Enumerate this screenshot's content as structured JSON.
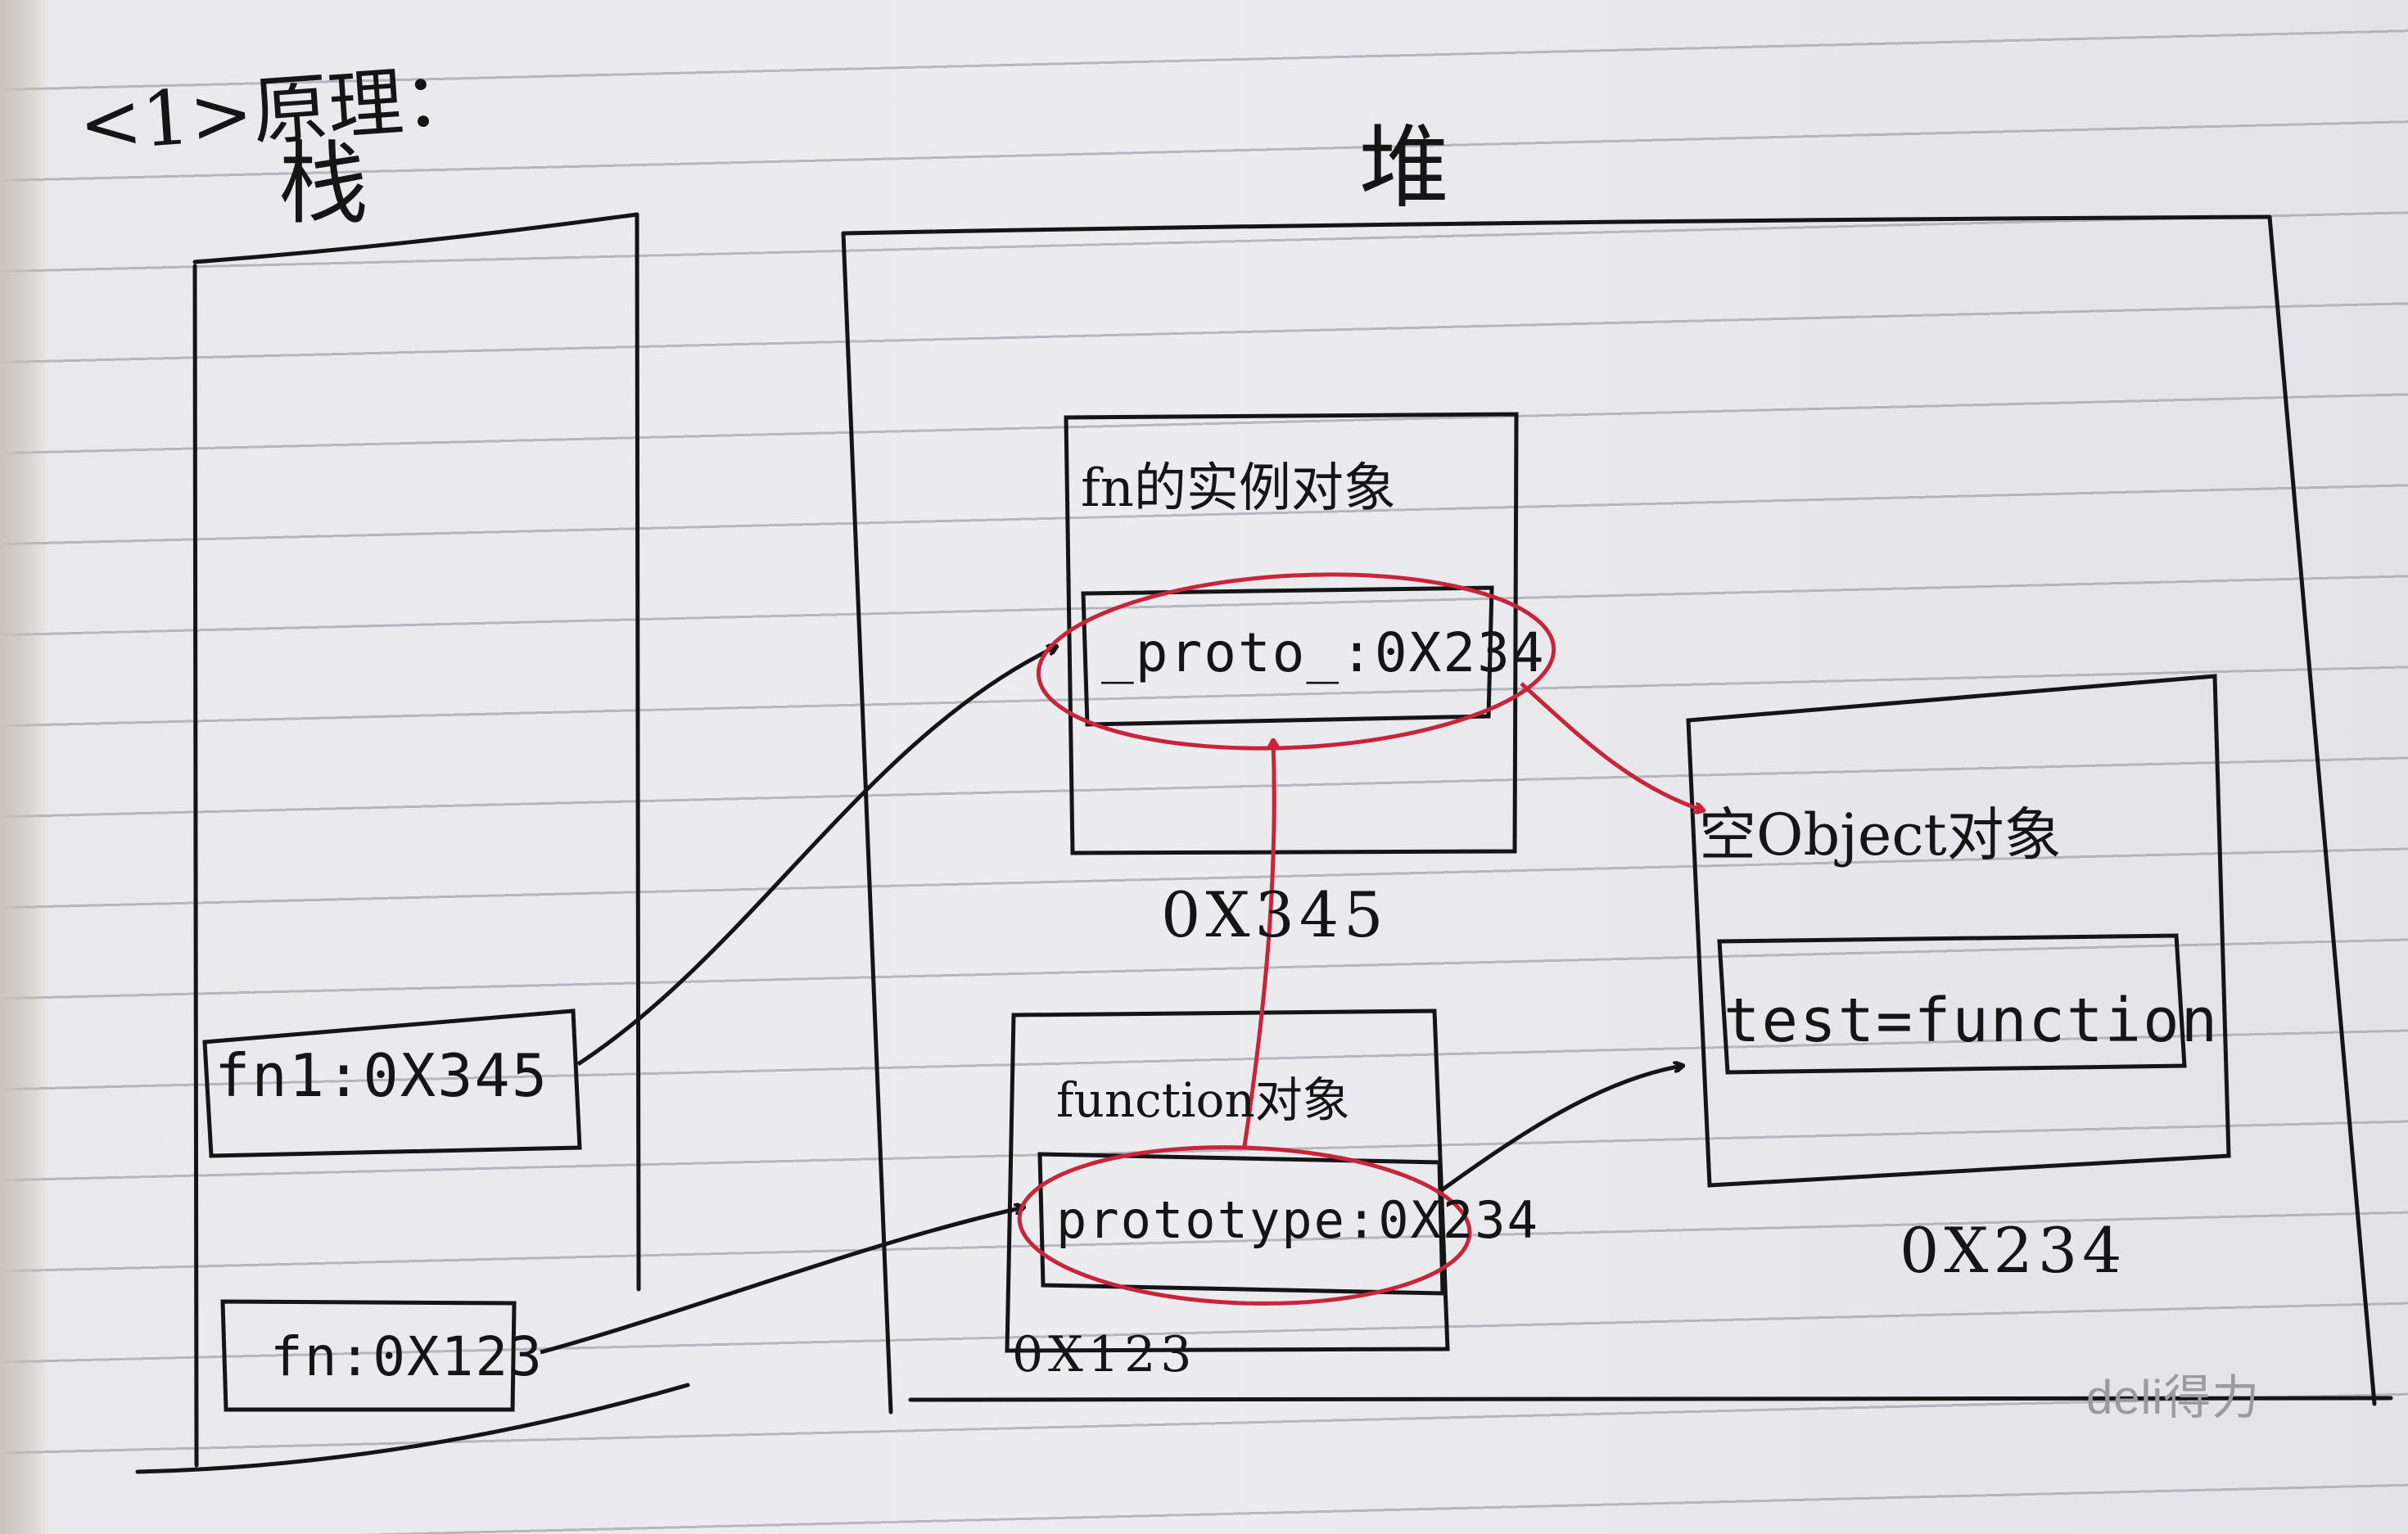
{
  "colors": {
    "ink": "#151515",
    "red_ink": "#c8243a",
    "paper": "#ececef",
    "rule_line": "#8c8c96"
  },
  "header_note": "<1>原理：",
  "stack": {
    "label": "栈",
    "slots": [
      "fn1:0X345",
      "fn:0X123"
    ]
  },
  "heap": {
    "label": "堆",
    "objects": [
      {
        "title": "fn的实例对象",
        "slot": "_proto_:0X234",
        "address": "0X345"
      },
      {
        "title": "function对象",
        "slot": "prototype:0X234",
        "address": "0X123"
      },
      {
        "title": "空Object对象",
        "slot": "test=function",
        "address": "0X234"
      }
    ]
  },
  "brand": "deli得力"
}
